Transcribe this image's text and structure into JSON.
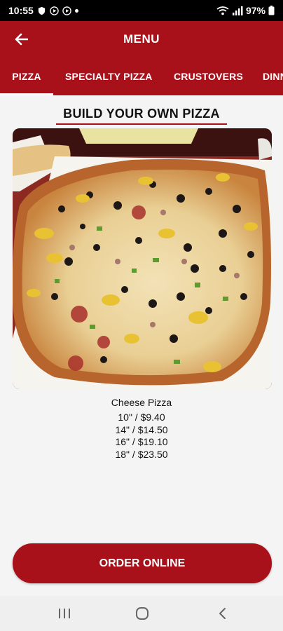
{
  "status_bar": {
    "time": "10:55",
    "battery": "97%",
    "icons": [
      "shield-icon",
      "play-icon",
      "play-icon",
      "dot-icon",
      "wifi-icon",
      "signal-icon",
      "battery-icon"
    ]
  },
  "app_bar": {
    "title": "MENU",
    "back_icon": "arrow-left-icon"
  },
  "tabs": [
    {
      "label": "PIZZA",
      "active": true
    },
    {
      "label": "SPECIALTY PIZZA",
      "active": false
    },
    {
      "label": "CRUSTOVERS",
      "active": false
    },
    {
      "label": "DINN",
      "active": false
    }
  ],
  "section": {
    "title": "BUILD YOUR OWN PIZZA"
  },
  "item": {
    "name": "Cheese Pizza",
    "prices": [
      "10\" / $9.40",
      "14\" / $14.50",
      "16\" / $19.10",
      "18\" / $23.50"
    ]
  },
  "order_button": {
    "label": "ORDER ONLINE"
  },
  "colors": {
    "brand_red": "#a8101a",
    "background": "#f4f4f4"
  },
  "nav_bar": {
    "icons": [
      "recent-apps-icon",
      "home-icon",
      "back-icon"
    ]
  }
}
